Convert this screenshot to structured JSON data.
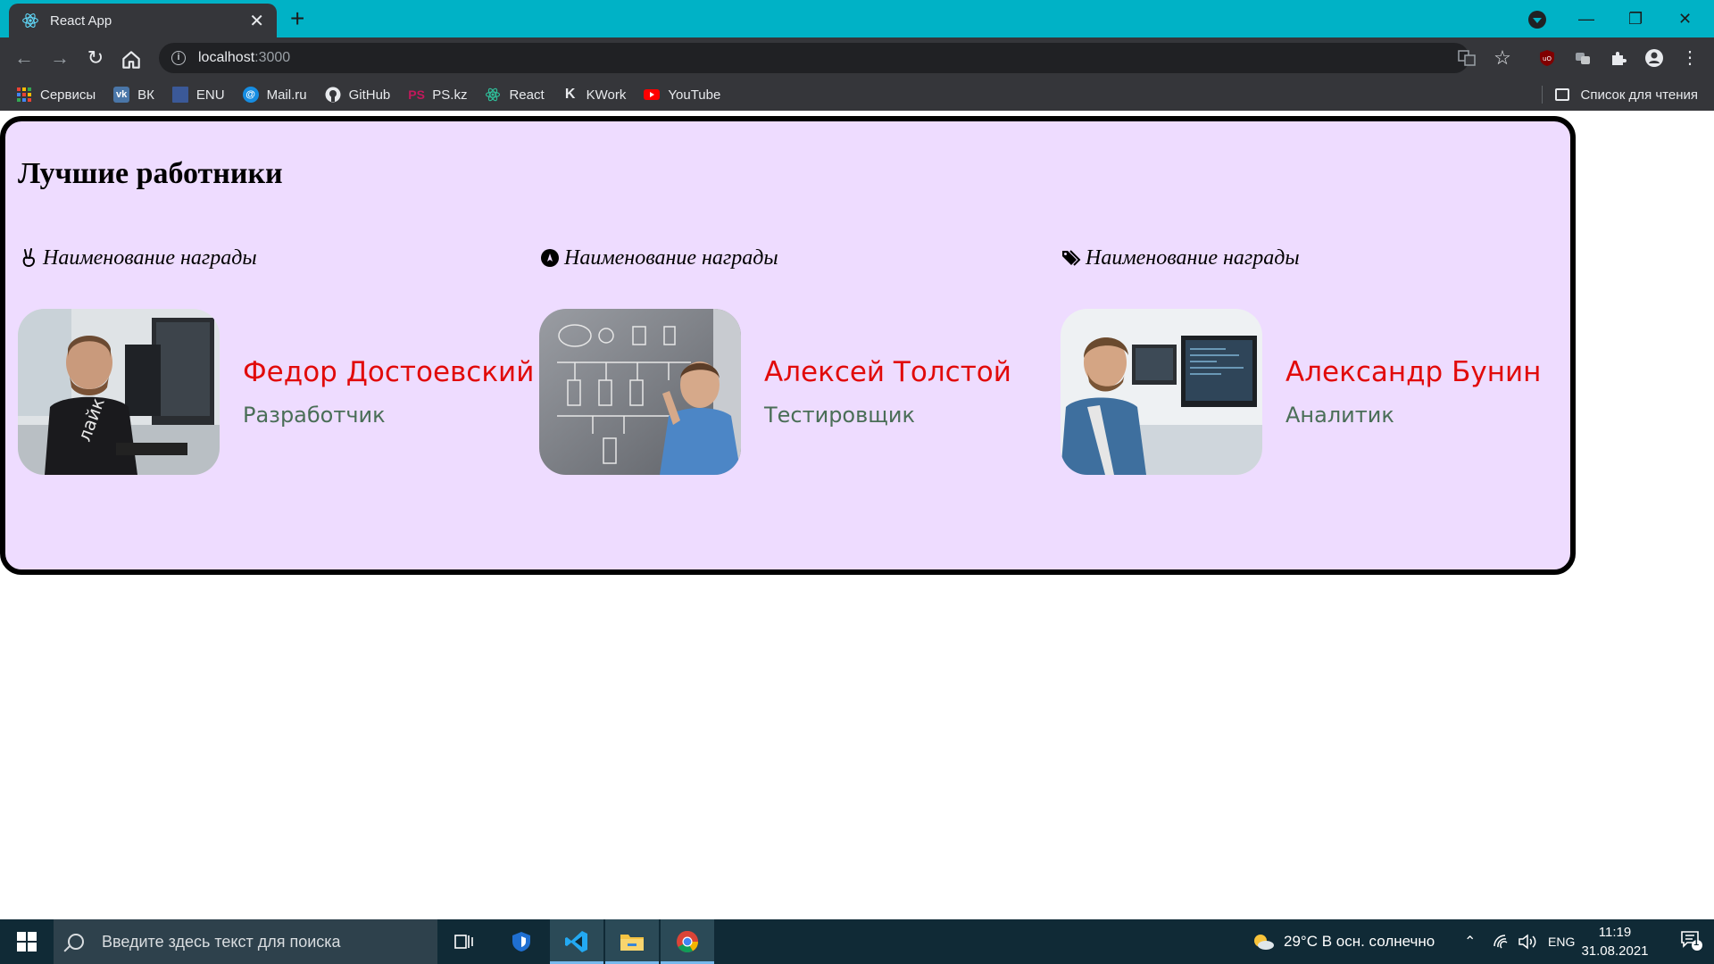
{
  "browser": {
    "tab_title": "React App",
    "tab_close": "✕",
    "new_tab": "+",
    "url_host": "localhost",
    "url_port": ":3000",
    "window_controls": {
      "minimize": "—",
      "restore": "❐",
      "close": "✕"
    }
  },
  "bookmarks": [
    {
      "label": "Сервисы",
      "icon": "apps-grid-icon"
    },
    {
      "label": "ВК",
      "icon": "vk-icon"
    },
    {
      "label": "ENU",
      "icon": "enu-icon"
    },
    {
      "label": "Mail.ru",
      "icon": "mailru-icon"
    },
    {
      "label": "GitHub",
      "icon": "github-icon"
    },
    {
      "label": "PS.kz",
      "icon": "pskz-icon"
    },
    {
      "label": "React",
      "icon": "react-icon"
    },
    {
      "label": "KWork",
      "icon": "kwork-icon"
    },
    {
      "label": "YouTube",
      "icon": "youtube-icon"
    }
  ],
  "reading_list": "Список для чтения",
  "page": {
    "title": "Лучшие работники",
    "awards": [
      {
        "award_name": "Наименование награды",
        "icon": "peace-hand-icon",
        "worker_name": "Федор Достоевский",
        "worker_role": "Разработчик"
      },
      {
        "award_name": "Наименование награды",
        "icon": "compass-icon",
        "worker_name": "Алексей Толстой",
        "worker_role": "Тестировщик"
      },
      {
        "award_name": "Наименование награды",
        "icon": "tags-icon",
        "worker_name": "Александр Бунин",
        "worker_role": "Аналитик"
      }
    ]
  },
  "taskbar": {
    "search_placeholder": "Введите здесь текст для поиска",
    "weather": "29°C  В осн. солнечно",
    "language": "ENG",
    "time": "11:19",
    "date": "31.08.2021",
    "notifications": "1"
  },
  "colors": {
    "tab_bar": "#00b2c6",
    "card_background": "#eedcff",
    "worker_name": "#e10a0a",
    "worker_role": "#4a6e57"
  }
}
